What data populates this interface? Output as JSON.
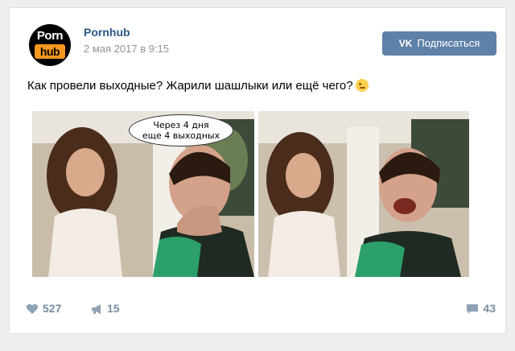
{
  "post": {
    "author": "Pornhub",
    "date": "2 мая 2017 в 9:15",
    "avatar_top": "Porn",
    "avatar_bottom": "hub",
    "subscribe_logo": "VK",
    "subscribe_label": "Подписаться",
    "text": "Как провели выходные? Жарили шашлыки или ещё чего?",
    "photo1_caption_line1": "Через 4 дня",
    "photo1_caption_line2": "еще 4 выходных",
    "likes": "527",
    "shares": "15",
    "comments": "43"
  },
  "colors": {
    "link": "#2a5885",
    "button": "#5e81a8",
    "muted": "#939393",
    "footer_icon": "#8fa1b4"
  },
  "icons": [
    "heart-icon",
    "megaphone-icon",
    "comment-icon",
    "winking-emoji-icon"
  ]
}
